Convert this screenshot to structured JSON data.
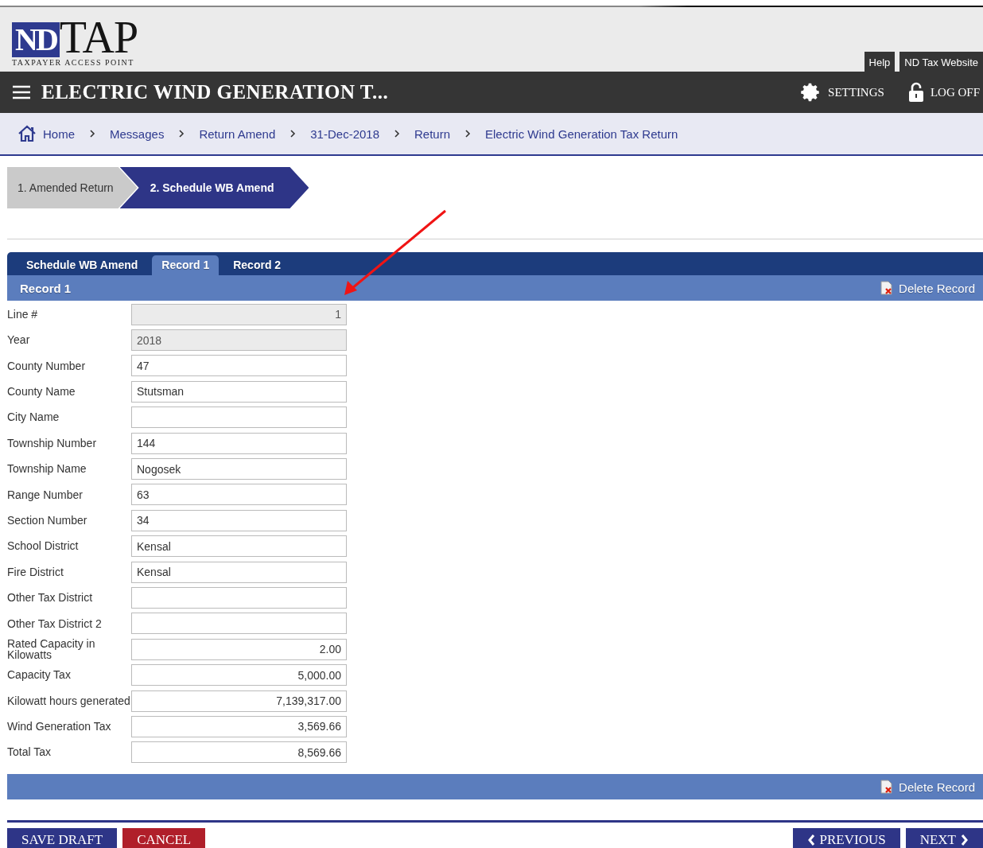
{
  "logo": {
    "mark": "ND",
    "name": "TAP",
    "tagline": "TAXPAYER ACCESS POINT"
  },
  "top_links": [
    "Help",
    "ND Tax Website"
  ],
  "title_bar": {
    "title": "ELECTRIC WIND GENERATION T...",
    "settings": "SETTINGS",
    "log_off": "LOG OFF"
  },
  "breadcrumbs": [
    "Home",
    "Messages",
    "Return Amend",
    "31-Dec-2018",
    "Return",
    "Electric Wind Generation Tax Return"
  ],
  "steps": [
    {
      "label": "1. Amended Return",
      "selected": false
    },
    {
      "label": "2. Schedule WB Amend",
      "selected": true
    }
  ],
  "tabs": [
    {
      "label": "Schedule WB Amend",
      "selected": false
    },
    {
      "label": "Record 1",
      "selected": true
    },
    {
      "label": "Record 2",
      "selected": false
    }
  ],
  "section": {
    "title": "Record 1",
    "delete_top": "Delete Record",
    "delete_bottom": "Delete Record"
  },
  "fields": [
    {
      "label": "Line #",
      "value": "1",
      "kind": "number",
      "disabled": true
    },
    {
      "label": "Year",
      "value": "2018",
      "kind": "text",
      "disabled": true
    },
    {
      "label": "County Number",
      "value": "47",
      "kind": "text",
      "disabled": false
    },
    {
      "label": "County Name",
      "value": "Stutsman",
      "kind": "text",
      "disabled": false
    },
    {
      "label": "City Name",
      "kind": "text",
      "disabled": false
    },
    {
      "label": "Township Number",
      "value": "144",
      "kind": "text",
      "disabled": false
    },
    {
      "label": "Township Name",
      "value": "Nogosek",
      "kind": "text",
      "disabled": false
    },
    {
      "label": "Range Number",
      "value": "63",
      "kind": "text",
      "disabled": false
    },
    {
      "label": "Section Number",
      "value": "34",
      "kind": "text",
      "disabled": false
    },
    {
      "label": "School District",
      "value": "Kensal",
      "kind": "text",
      "disabled": false
    },
    {
      "label": "Fire District",
      "value": "Kensal",
      "kind": "text",
      "disabled": false
    },
    {
      "label": "Other Tax District",
      "kind": "text",
      "disabled": false
    },
    {
      "label": "Other Tax District 2",
      "kind": "text",
      "disabled": false
    },
    {
      "label": "Rated Capacity in Kilowatts",
      "value": "2.00",
      "kind": "number",
      "disabled": false
    },
    {
      "label": "Capacity Tax",
      "value": "5,000.00",
      "kind": "number",
      "disabled": false
    },
    {
      "label": "Kilowatt hours generated",
      "value": "7,139,317.00",
      "kind": "number",
      "disabled": false
    },
    {
      "label": "Wind Generation Tax",
      "value": "3,569.66",
      "kind": "number",
      "disabled": false
    },
    {
      "label": "Total Tax",
      "value": "8,569.66",
      "kind": "number",
      "disabled": false
    }
  ],
  "buttons": {
    "save_draft": "SAVE DRAFT",
    "cancel": "CANCEL",
    "previous": "PREVIOUS",
    "next": "NEXT"
  }
}
